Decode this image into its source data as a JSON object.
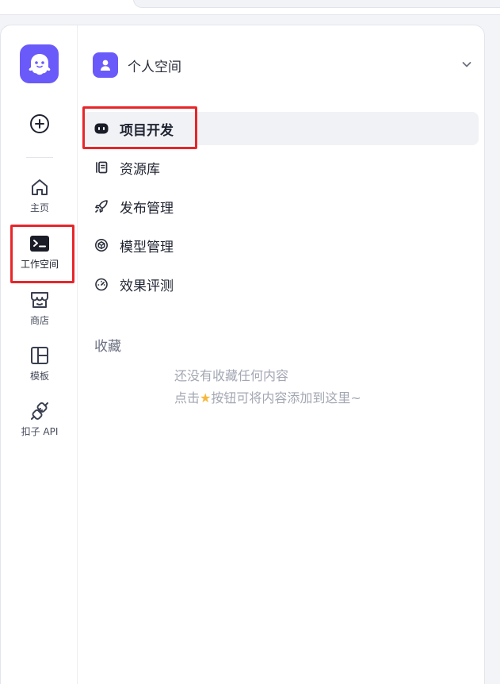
{
  "workspace": {
    "name": "个人空间"
  },
  "rail": {
    "items": [
      {
        "key": "home",
        "label": "主页",
        "icon": "home-icon"
      },
      {
        "key": "workspace",
        "label": "工作空间",
        "icon": "terminal-icon",
        "active": true
      },
      {
        "key": "store",
        "label": "商店",
        "icon": "store-icon"
      },
      {
        "key": "templates",
        "label": "模板",
        "icon": "layout-icon"
      },
      {
        "key": "api",
        "label": "扣子 API",
        "icon": "plug-icon"
      }
    ]
  },
  "nav": {
    "items": [
      {
        "key": "projects",
        "label": "项目开发",
        "icon": "bot-icon",
        "active": true
      },
      {
        "key": "library",
        "label": "资源库",
        "icon": "library-icon"
      },
      {
        "key": "publish",
        "label": "发布管理",
        "icon": "rocket-icon"
      },
      {
        "key": "models",
        "label": "模型管理",
        "icon": "cube-icon"
      },
      {
        "key": "evaluation",
        "label": "效果评测",
        "icon": "gauge-icon"
      }
    ]
  },
  "favorites": {
    "title": "收藏",
    "empty_line1": "还没有收藏任何内容",
    "empty_line2_prefix": "点击",
    "empty_line2_suffix": "按钮可将内容添加到这里~",
    "star_icon": "star-icon"
  },
  "colors": {
    "brand": "#6a5af9",
    "highlight": "#e8262a",
    "star": "#f5b83d"
  }
}
